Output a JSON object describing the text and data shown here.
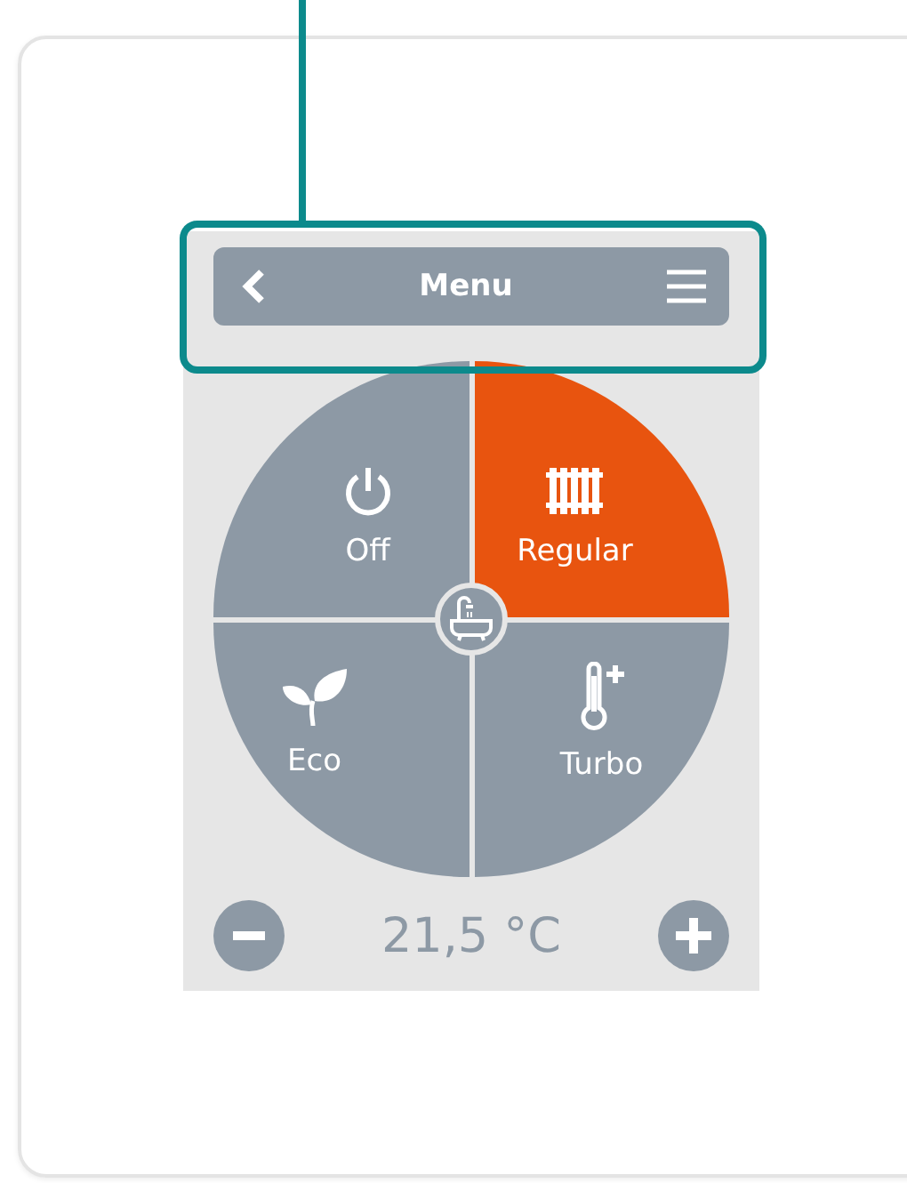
{
  "menu_bar": {
    "title": "Menu"
  },
  "modes": [
    {
      "kind": "off",
      "label": "Off",
      "selected": false
    },
    {
      "kind": "regular",
      "label": "Regular",
      "selected": true
    },
    {
      "kind": "eco",
      "label": "Eco",
      "selected": false
    },
    {
      "kind": "turbo",
      "label": "Turbo",
      "selected": false
    }
  ],
  "temperature": "21,5 °C"
}
